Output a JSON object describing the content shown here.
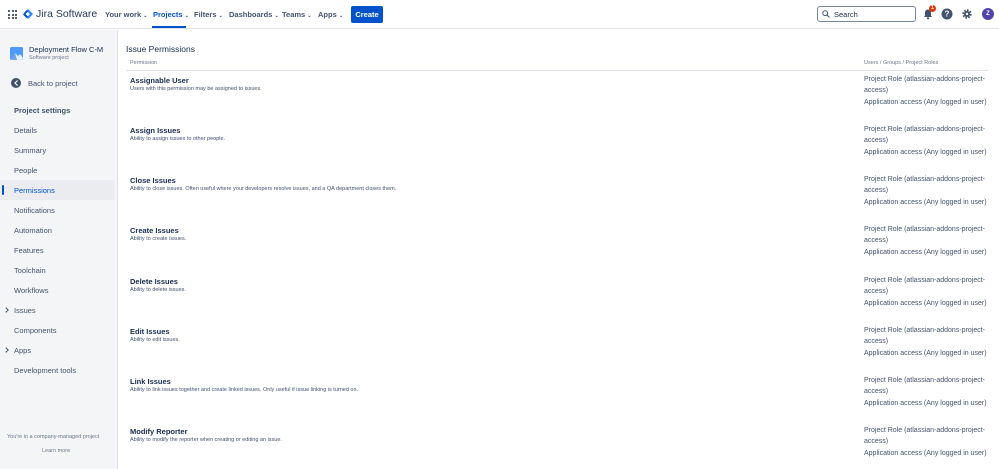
{
  "topnav": {
    "product": "Jira Software",
    "menus": [
      "Your work",
      "Projects",
      "Filters",
      "Dashboards",
      "Teams",
      "Apps"
    ],
    "create_label": "Create",
    "search_placeholder": "Search",
    "notification_count": "1",
    "avatar_initial": "Z"
  },
  "sidebar": {
    "project_name": "Deployment Flow C-M",
    "project_type": "Software project",
    "back_label": "Back to project",
    "section_title": "Project settings",
    "items": [
      {
        "label": "Details"
      },
      {
        "label": "Summary"
      },
      {
        "label": "People"
      },
      {
        "label": "Permissions"
      },
      {
        "label": "Notifications"
      },
      {
        "label": "Automation"
      },
      {
        "label": "Features"
      },
      {
        "label": "Toolchain"
      },
      {
        "label": "Workflows"
      },
      {
        "label": "Issues"
      },
      {
        "label": "Components"
      },
      {
        "label": "Apps"
      },
      {
        "label": "Development tools"
      }
    ],
    "footer_text": "You're in a company-managed project",
    "learn_more": "Learn more"
  },
  "main": {
    "title": "Issue Permissions",
    "col_permission": "Permission",
    "col_roles": "Users / Groups / Project Roles",
    "role_line1": "Project Role (atlassian-addons-project-access)",
    "role_line2": "Application access (Any logged in user)",
    "permissions": [
      {
        "name": "Assignable User",
        "desc": "Users with this permission may be assigned to issues."
      },
      {
        "name": "Assign Issues",
        "desc": "Ability to assign issues to other people."
      },
      {
        "name": "Close Issues",
        "desc": "Ability to close issues. Often useful where your developers resolve issues, and a QA department closes them."
      },
      {
        "name": "Create Issues",
        "desc": "Ability to create issues."
      },
      {
        "name": "Delete Issues",
        "desc": "Ability to delete issues."
      },
      {
        "name": "Edit Issues",
        "desc": "Ability to edit issues."
      },
      {
        "name": "Link Issues",
        "desc": "Ability to link issues together and create linked issues. Only useful if issue linking is turned on."
      },
      {
        "name": "Modify Reporter",
        "desc": "Ability to modify the reporter when creating or editing an issue."
      }
    ]
  }
}
